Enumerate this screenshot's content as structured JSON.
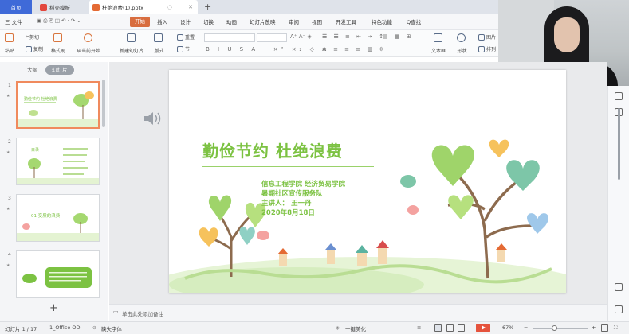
{
  "tabs": {
    "home": "首页",
    "template": "稻壳模板",
    "document": "杜绝浪费(1).pptx"
  },
  "menu": {
    "file": "三 文件",
    "start": "开始",
    "items": [
      "插入",
      "设计",
      "切换",
      "动画",
      "幻灯片放映",
      "审阅",
      "视图",
      "开发工具",
      "特色功能"
    ],
    "search": "Q查找"
  },
  "ribbon": {
    "paste": "粘贴",
    "cut": "剪切",
    "copy": "复制",
    "format_painter": "格式刷",
    "from_current": "从当前开始",
    "new_slide": "新建幻灯片",
    "layout": "版式",
    "section": "节",
    "reset": "重置",
    "textbox": "文本框",
    "shape": "形状",
    "picture": "图片",
    "arrange": "排列"
  },
  "left_panel": {
    "tab_outline": "大纲",
    "tab_slides": "幻灯片",
    "thumbs": [
      {
        "num": "1",
        "title": "勤俭节约 杜绝浪费"
      },
      {
        "num": "2",
        "title": "目录"
      },
      {
        "num": "3",
        "title": "01  变质的浪费"
      },
      {
        "num": "4",
        "title": ""
      }
    ]
  },
  "slide": {
    "title": "勤俭节约  杜绝浪费",
    "lines": [
      "信息工程学院    经济贸易学院",
      "暑期社区宣传服务队",
      "主讲人：  王一丹",
      "2020年8月18日"
    ]
  },
  "notes": {
    "placeholder": "单击此处添加备注"
  },
  "status": {
    "slide_count": "幻灯片 1 / 17",
    "theme": "1_Office OD",
    "font_missing": "缺失字体",
    "beautify": "一键美化",
    "zoom": "67%"
  },
  "colors": {
    "accent_orange": "#d86d3f",
    "title_green": "#7cc242",
    "play_red": "#e5533d"
  }
}
